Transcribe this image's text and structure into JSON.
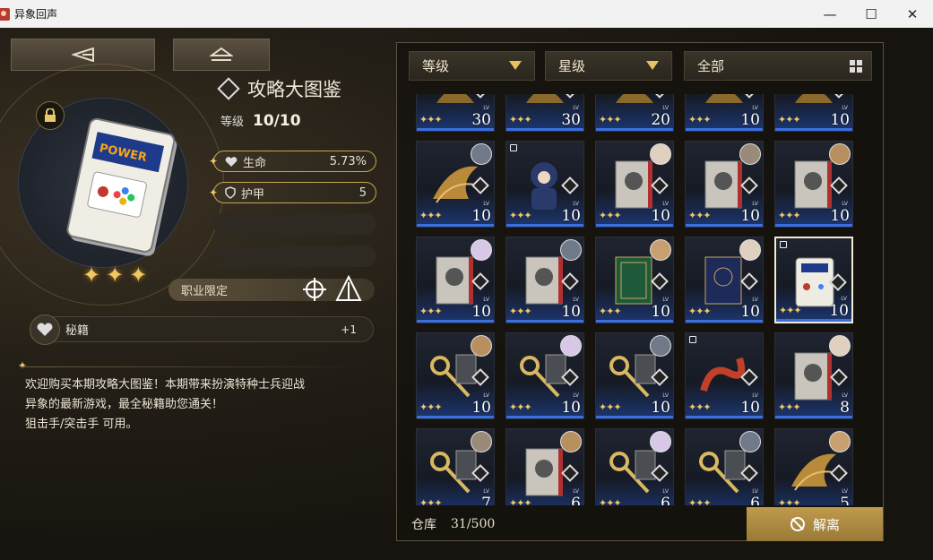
{
  "window": {
    "title": "异象回声"
  },
  "item": {
    "name": "攻略大图鉴",
    "level_label": "等级",
    "level_value": "10/10",
    "stats": [
      {
        "name": "生命",
        "value": "5.73%"
      },
      {
        "name": "护甲",
        "value": "5"
      }
    ],
    "job_limit_label": "职业限定",
    "secret_label": "秘籍",
    "secret_value": "+1",
    "description_line1": "欢迎购买本期攻略大图鉴！本期带来扮演特种士兵迎战",
    "description_line2": "异象的最新游戏，最全秘籍助您通关！",
    "description_line3": "狙击手/突击手 可用。",
    "stars": 3,
    "cover_text": "POWER"
  },
  "filters": {
    "level": "等级",
    "rarity": "星级",
    "all": "全部"
  },
  "inventory": [
    {
      "lv": "30",
      "art": "bronze",
      "stars": 3
    },
    {
      "lv": "30",
      "art": "bronze",
      "stars": 3
    },
    {
      "lv": "20",
      "art": "bronze",
      "stars": 3
    },
    {
      "lv": "10",
      "art": "bronze",
      "stars": 3
    },
    {
      "lv": "10",
      "art": "bronze",
      "stars": 3
    },
    {
      "lv": "10",
      "art": "wings",
      "stars": 3
    },
    {
      "lv": "10",
      "art": "figure",
      "stars": 3
    },
    {
      "lv": "10",
      "art": "book",
      "stars": 3
    },
    {
      "lv": "10",
      "art": "book",
      "stars": 3
    },
    {
      "lv": "10",
      "art": "book",
      "stars": 3
    },
    {
      "lv": "10",
      "art": "book",
      "stars": 3
    },
    {
      "lv": "10",
      "art": "book",
      "stars": 3
    },
    {
      "lv": "10",
      "art": "greenbook",
      "stars": 3
    },
    {
      "lv": "10",
      "art": "bluebook",
      "stars": 3
    },
    {
      "lv": "10",
      "art": "guide",
      "stars": 3
    },
    {
      "lv": "10",
      "art": "key",
      "stars": 3
    },
    {
      "lv": "10",
      "art": "key",
      "stars": 3
    },
    {
      "lv": "10",
      "art": "key",
      "stars": 3
    },
    {
      "lv": "10",
      "art": "snake",
      "stars": 3
    },
    {
      "lv": "8",
      "art": "book",
      "stars": 3
    },
    {
      "lv": "7",
      "art": "key",
      "stars": 3
    },
    {
      "lv": "6",
      "art": "book",
      "stars": 3
    },
    {
      "lv": "6",
      "art": "key",
      "stars": 3
    },
    {
      "lv": "6",
      "art": "key",
      "stars": 3
    },
    {
      "lv": "5",
      "art": "wings",
      "stars": 3
    }
  ],
  "storage": {
    "label": "仓库",
    "count": "31/500"
  },
  "dismantle_label": "解离",
  "colors": {
    "accent": "#c8a552",
    "selected_lv_glow": "#3a6fe0"
  }
}
